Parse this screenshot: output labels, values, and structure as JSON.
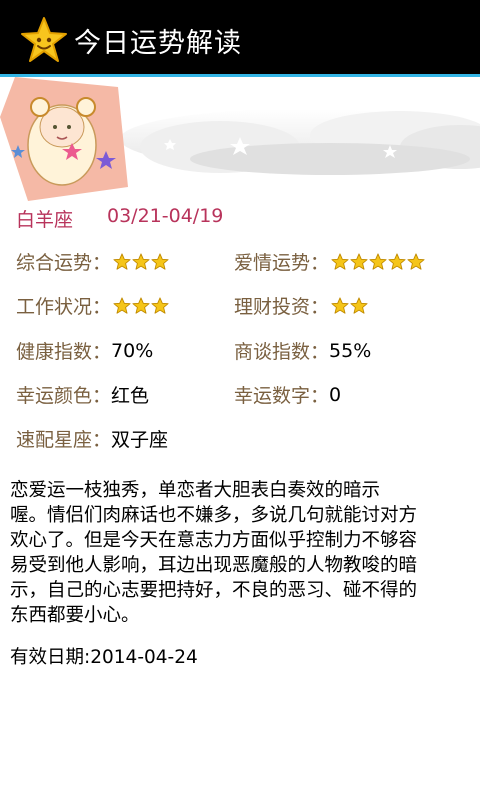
{
  "header": {
    "title": "今日运势解读",
    "icon": "star-face-icon"
  },
  "sign": {
    "name": "白羊座",
    "date_range": "03/21-04/19"
  },
  "info": [
    {
      "label": "综合运势",
      "stars": 3
    },
    {
      "label": "爱情运势",
      "stars": 5
    },
    {
      "label": "工作状况",
      "stars": 3
    },
    {
      "label": "理财投资",
      "stars": 2
    },
    {
      "label": "健康指数",
      "value": "70%"
    },
    {
      "label": "商谈指数",
      "value": "55%"
    },
    {
      "label": "幸运颜色",
      "value": "红色"
    },
    {
      "label": "幸运数字",
      "value": "0"
    },
    {
      "label": "速配星座",
      "value": "双子座"
    }
  ],
  "colon": "：",
  "description_lines": [
    "恋爱运一枝独秀，单恋者大胆表白奏效的暗示",
    "喔。情侣们肉麻话也不嫌多，多说几句就能讨对方",
    "欢心了。但是今天在意志力方面似乎控制力不够容",
    "易受到他人影响，耳边出现恶魔般的人物教唆的暗",
    "示，自己的心志要把持好，不良的恶习、碰不得的",
    "东西都要小心。"
  ],
  "valid_date": "有效日期:2014-04-24",
  "colors": {
    "accent_line": "#33b5e5",
    "sign_text": "#b8335b",
    "label_text": "#7a6040",
    "star": "#f5c518"
  }
}
